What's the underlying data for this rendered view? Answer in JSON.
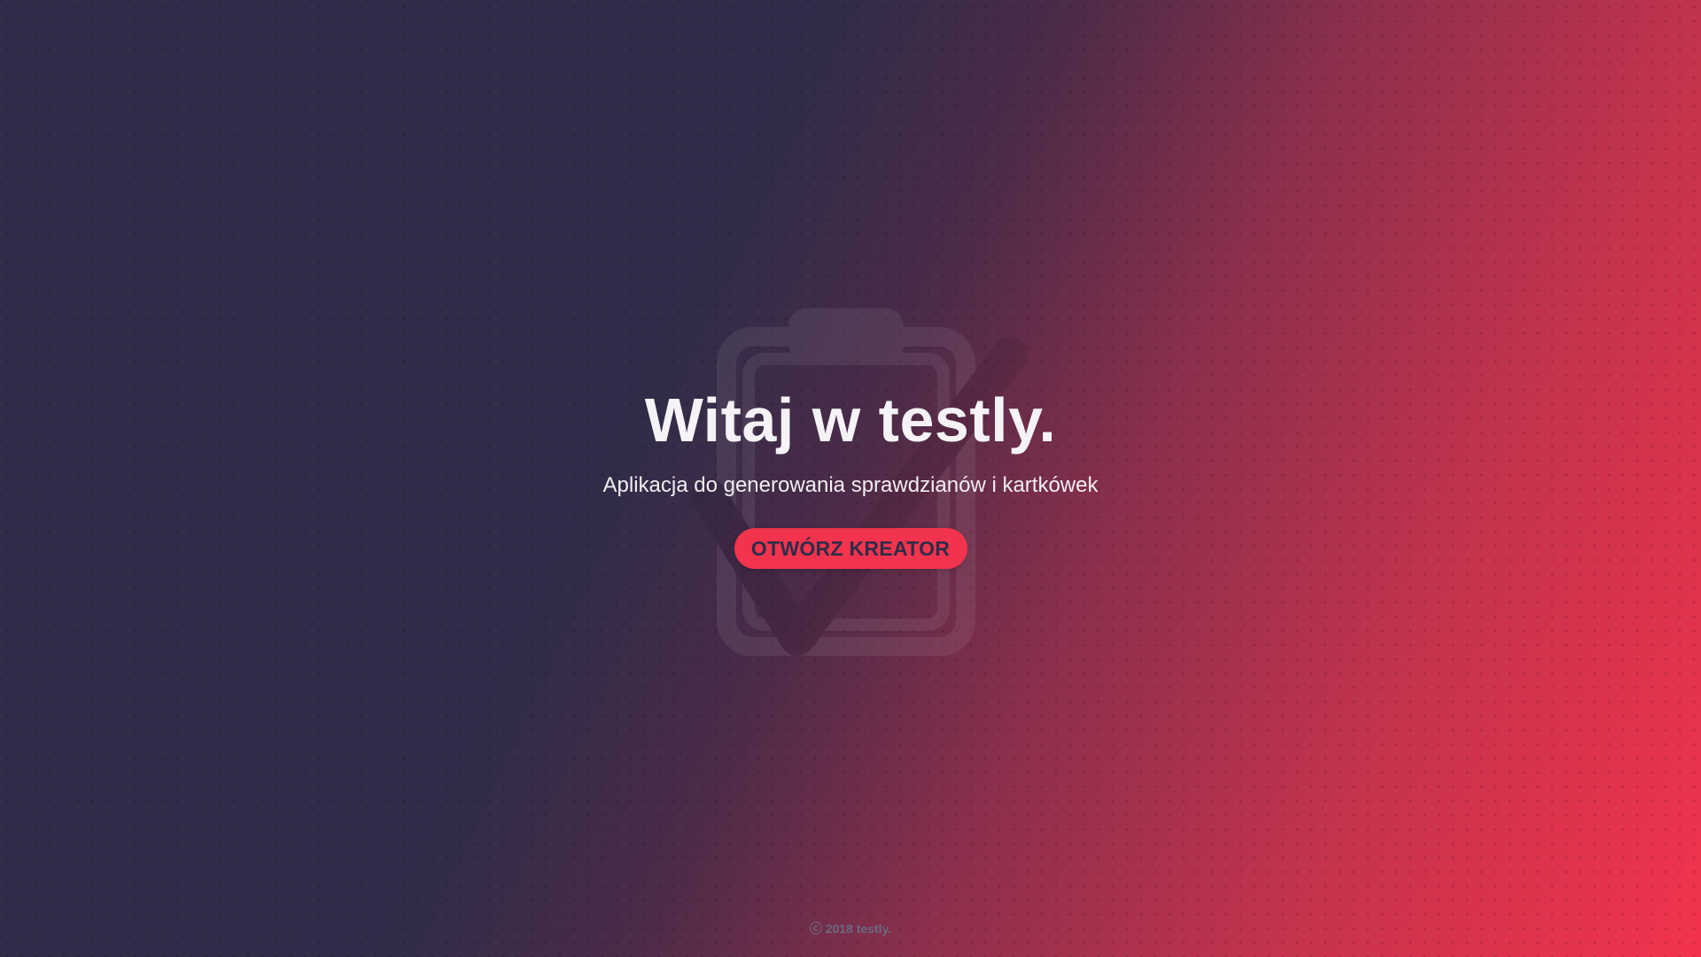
{
  "hero": {
    "title": "Witaj w testly.",
    "subtitle": "Aplikacja do generowania sprawdzianów i kartkówek",
    "cta_label": "OTWÓRZ KREATOR",
    "watermark_icon": "clipboard-check-icon"
  },
  "footer": {
    "copyright": "ⓒ 2018 testly."
  },
  "colors": {
    "background_dark": "#2e2c48",
    "background_red": "#f3334d",
    "accent": "#f2334d"
  }
}
